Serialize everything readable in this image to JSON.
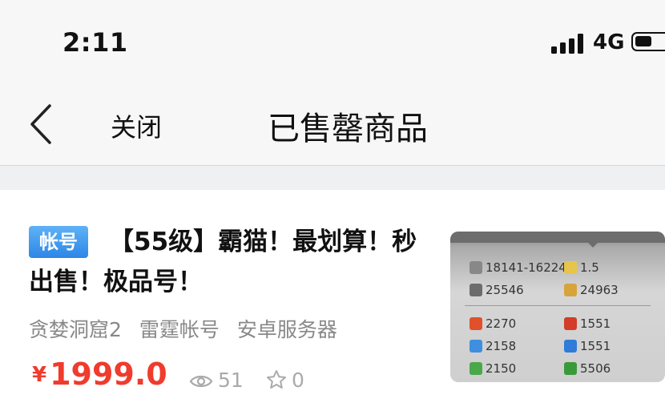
{
  "status_bar": {
    "time": "2:11",
    "network": "4G"
  },
  "nav": {
    "close_label": "关闭",
    "title": "已售罄商品"
  },
  "product": {
    "badge": "帐号",
    "title": "【55级】霸猫！最划算！秒出售！极品号！",
    "tags": [
      "贪婪洞窟2",
      "雷霆帐号",
      "安卓服务器"
    ],
    "currency": "¥",
    "price": "1999.0",
    "views": "51",
    "favorites": "0",
    "thumbnail": {
      "row1": [
        "18141-162243",
        "1.5"
      ],
      "row2": [
        "25546",
        "24963"
      ],
      "row3": [
        "2270",
        "1551"
      ],
      "row4": [
        "2158",
        "1551"
      ],
      "row5": [
        "2150",
        "5506"
      ]
    }
  },
  "colors": {
    "price": "#f03b2d",
    "badge": "#2c86e6",
    "muted": "#888888"
  },
  "icons": {
    "back": "chevron-left-icon",
    "views": "eye-icon",
    "favorites": "star-icon"
  }
}
